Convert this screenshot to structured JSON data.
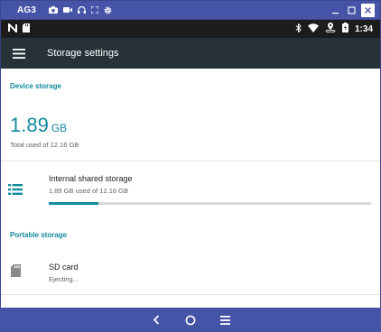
{
  "window": {
    "title": "AG3",
    "tools": [
      "camera-icon",
      "video-icon",
      "headphones-icon",
      "fullscreen-icon",
      "settings-icon"
    ],
    "controls": [
      "minimize-icon",
      "maximize-icon",
      "close-icon"
    ]
  },
  "status_bar": {
    "left_icons": [
      "n-notification-icon",
      "sd-card-notification-icon"
    ],
    "right_icons": [
      "bluetooth-icon",
      "wifi-icon",
      "location-icon",
      "battery-icon"
    ],
    "time": "1:34"
  },
  "app_bar": {
    "title": "Storage settings"
  },
  "device_storage": {
    "header": "Device storage",
    "used_value": "1.89",
    "used_unit": "GB",
    "total_label": "Total used of 12.16 GB"
  },
  "internal_storage": {
    "title": "Internal shared storage",
    "summary": "1.89 GB used of 12.16 GB",
    "progress_fraction": 0.155
  },
  "portable_storage": {
    "header": "Portable storage",
    "sd_card": {
      "title": "SD card",
      "status": "Ejecting..."
    }
  },
  "nav_bar": {
    "buttons": [
      "back-icon",
      "home-icon",
      "recents-icon"
    ]
  },
  "colors": {
    "accent": "#138a9e",
    "app_bar": "#263238",
    "frame": "#4654a8",
    "status_bar": "#1c1c1c"
  }
}
